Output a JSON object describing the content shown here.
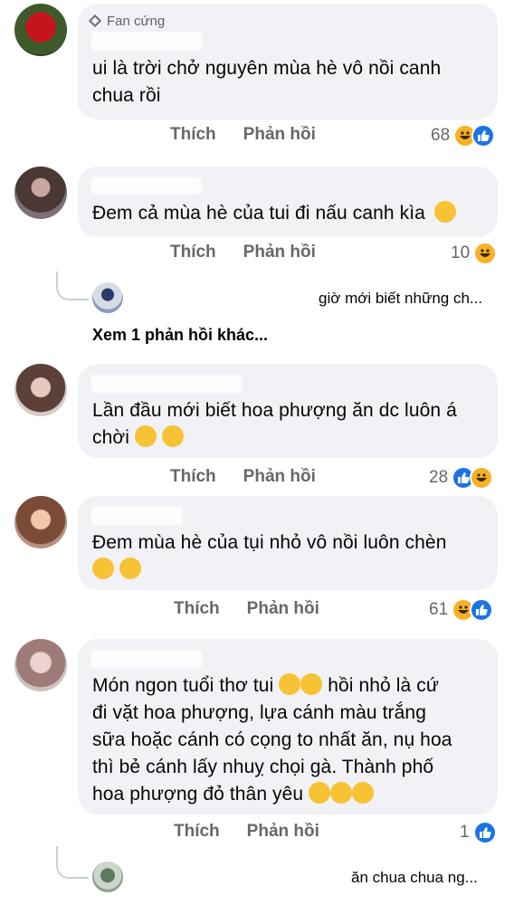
{
  "comments": [
    {
      "badge": "Fan cứng",
      "text_lines": [
        "ui là trời chở nguyên mùa hè vô nồi canh",
        "chua rồi"
      ],
      "like_label": "Thích",
      "reply_label": "Phản hồi",
      "reaction_count": "68",
      "reactions": [
        "haha",
        "like"
      ]
    },
    {
      "text_lines": [
        "Đem cả mùa hè của tui đi nấu canh kìa"
      ],
      "like_label": "Thích",
      "reply_label": "Phản hồi",
      "reaction_count": "10",
      "reactions": [
        "haha"
      ],
      "reply_preview": "giờ mới biết những ch...",
      "more_replies": "Xem 1 phản hồi khác..."
    },
    {
      "text_lines": [
        "Lần đầu mới biết hoa phượng ăn dc luôn á",
        "chời"
      ],
      "like_label": "Thích",
      "reply_label": "Phản hồi",
      "reaction_count": "28",
      "reactions": [
        "like",
        "haha"
      ]
    },
    {
      "text_lines": [
        "Đem mùa hè của tụi nhỏ vô nồi luôn chèn"
      ],
      "like_label": "Thích",
      "reply_label": "Phản hồi",
      "reaction_count": "61",
      "reactions": [
        "haha",
        "like"
      ]
    },
    {
      "text_lines": [
        "Món ngon tuổi thơ tui",
        "hồi nhỏ là cứ",
        "đi vặt hoa phượng, lựa cánh màu trắng",
        "sữa hoặc cánh có cọng to nhất ăn, nụ hoa",
        "thì bẻ cánh lấy nhuỵ chọi gà. Thành phố",
        "hoa phượng đỏ thân yêu"
      ],
      "like_label": "Thích",
      "reply_label": "Phản hồi",
      "reaction_count": "1",
      "reactions": [
        "like"
      ],
      "reply_preview": "ăn chua chua ng..."
    }
  ],
  "colors": {
    "bubble": "#f0f2f5",
    "meta_text": "#65676b",
    "like_blue": "#1b74e4",
    "haha_yellow": "#f7b125"
  },
  "emoji_names": [
    "grinning-squint-face",
    "flushed-face",
    "crying-laughing-face",
    "heart-eyes-face",
    "face-with-raised-eyebrows"
  ]
}
